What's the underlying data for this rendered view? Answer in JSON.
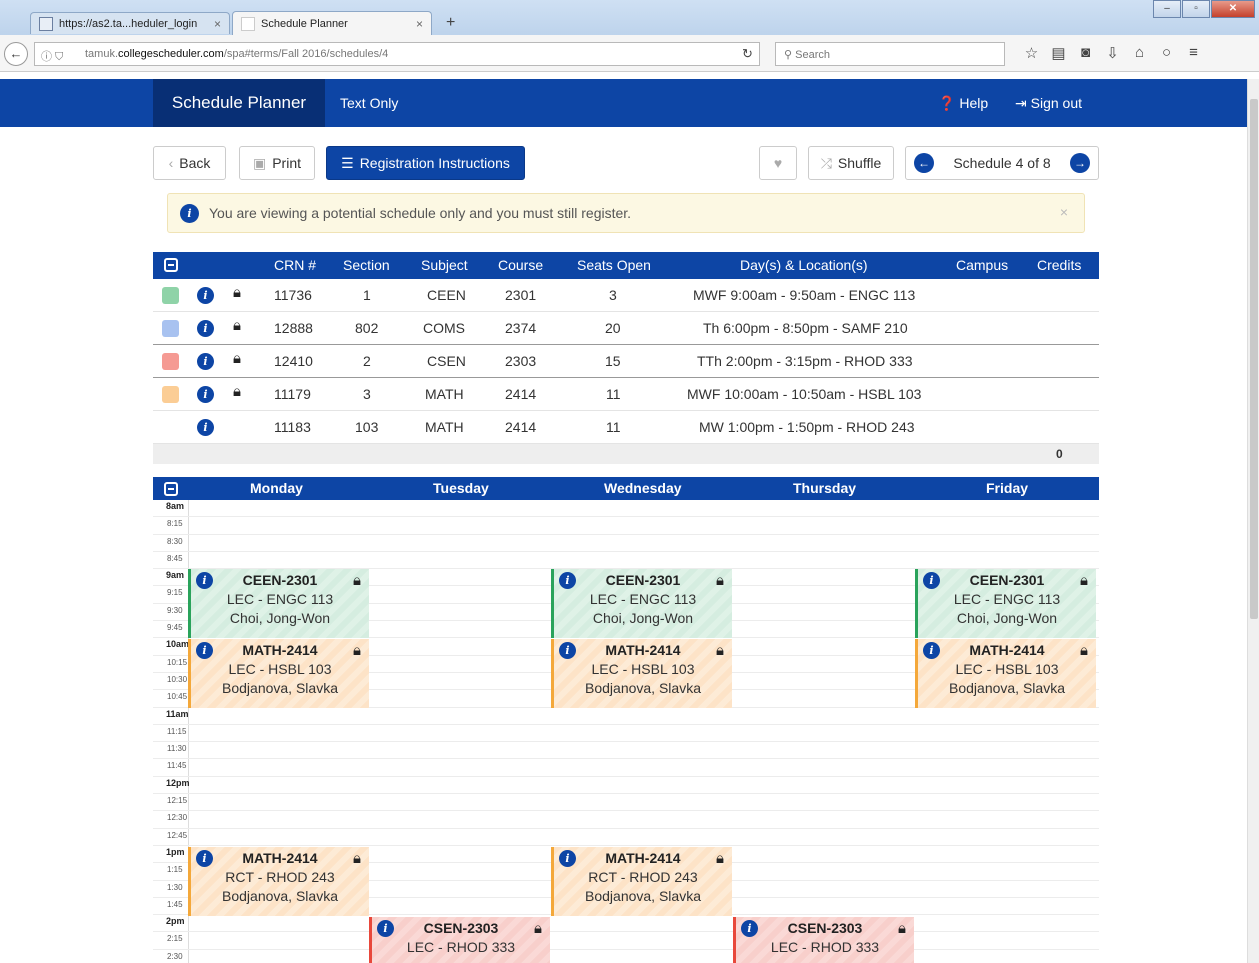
{
  "browser": {
    "tabs": [
      {
        "label": "https://as2.ta...heduler_login",
        "active": false
      },
      {
        "label": "Schedule Planner",
        "active": true
      }
    ],
    "url_prefix": "tamuk.",
    "url_domain": "collegescheduler.com",
    "url_path": "/spa#terms/Fall 2016/schedules/4",
    "search_placeholder": "Search"
  },
  "app": {
    "brand": "Schedule Planner",
    "text_only": "Text Only",
    "help": "Help",
    "sign_out": "Sign out"
  },
  "toolbar": {
    "back": "Back",
    "print": "Print",
    "registration": "Registration Instructions",
    "shuffle": "Shuffle",
    "schedule_label": "Schedule 4 of 8"
  },
  "alert": {
    "message": "You are viewing a potential schedule only and you must still register."
  },
  "course_table": {
    "headers": [
      "CRN #",
      "Section",
      "Subject",
      "Course",
      "Seats Open",
      "Day(s) & Location(s)",
      "Campus",
      "Credits"
    ],
    "rows": [
      {
        "crn": "11736",
        "section": "1",
        "subject": "CEEN",
        "course": "2301",
        "seats": "3",
        "location": "MWF 9:00am - 9:50am - ENGC 113",
        "color": "#8fd3a8"
      },
      {
        "crn": "12888",
        "section": "802",
        "subject": "COMS",
        "course": "2374",
        "seats": "20",
        "location": "Th 6:00pm - 8:50pm - SAMF 210",
        "color": "#a8c2f0"
      },
      {
        "crn": "12410",
        "section": "2",
        "subject": "CSEN",
        "course": "2303",
        "seats": "15",
        "location": "TTh 2:00pm - 3:15pm - RHOD 333",
        "color": "#f59a93"
      },
      {
        "crn": "11179",
        "section": "3",
        "subject": "MATH",
        "course": "2414",
        "seats": "11",
        "location": "MWF 10:00am - 10:50am - HSBL 103",
        "color": "#fbcd95"
      },
      {
        "crn": "11183",
        "section": "103",
        "subject": "MATH",
        "course": "2414",
        "seats": "11",
        "location": "MW 1:00pm - 1:50pm - RHOD 243",
        "color": ""
      }
    ],
    "credits_total": "0"
  },
  "calendar": {
    "days": [
      "Monday",
      "Tuesday",
      "Wednesday",
      "Thursday",
      "Friday"
    ],
    "times": [
      "8am",
      "8:15",
      "8:30",
      "8:45",
      "9am",
      "9:15",
      "9:30",
      "9:45",
      "10am",
      "10:15",
      "10:30",
      "10:45",
      "11am",
      "11:15",
      "11:30",
      "11:45",
      "12pm",
      "12:15",
      "12:30",
      "12:45",
      "1pm",
      "1:15",
      "1:30",
      "1:45",
      "2pm",
      "2:15",
      "2:30"
    ],
    "events": [
      {
        "title": "CEEN-2301",
        "line2": "LEC - ENGC 113",
        "line3": "Choi, Jong-Won"
      },
      {
        "title": "CEEN-2301",
        "line2": "LEC - ENGC 113",
        "line3": "Choi, Jong-Won"
      },
      {
        "title": "CEEN-2301",
        "line2": "LEC - ENGC 113",
        "line3": "Choi, Jong-Won"
      },
      {
        "title": "MATH-2414",
        "line2": "LEC - HSBL 103",
        "line3": "Bodjanova, Slavka"
      },
      {
        "title": "MATH-2414",
        "line2": "LEC - HSBL 103",
        "line3": "Bodjanova, Slavka"
      },
      {
        "title": "MATH-2414",
        "line2": "LEC - HSBL 103",
        "line3": "Bodjanova, Slavka"
      },
      {
        "title": "MATH-2414",
        "line2": "RCT - RHOD 243",
        "line3": "Bodjanova, Slavka"
      },
      {
        "title": "MATH-2414",
        "line2": "RCT - RHOD 243",
        "line3": "Bodjanova, Slavka"
      },
      {
        "title": "CSEN-2303",
        "line2": "LEC - RHOD 333",
        "line3": ""
      },
      {
        "title": "CSEN-2303",
        "line2": "LEC - RHOD 333",
        "line3": ""
      }
    ]
  }
}
